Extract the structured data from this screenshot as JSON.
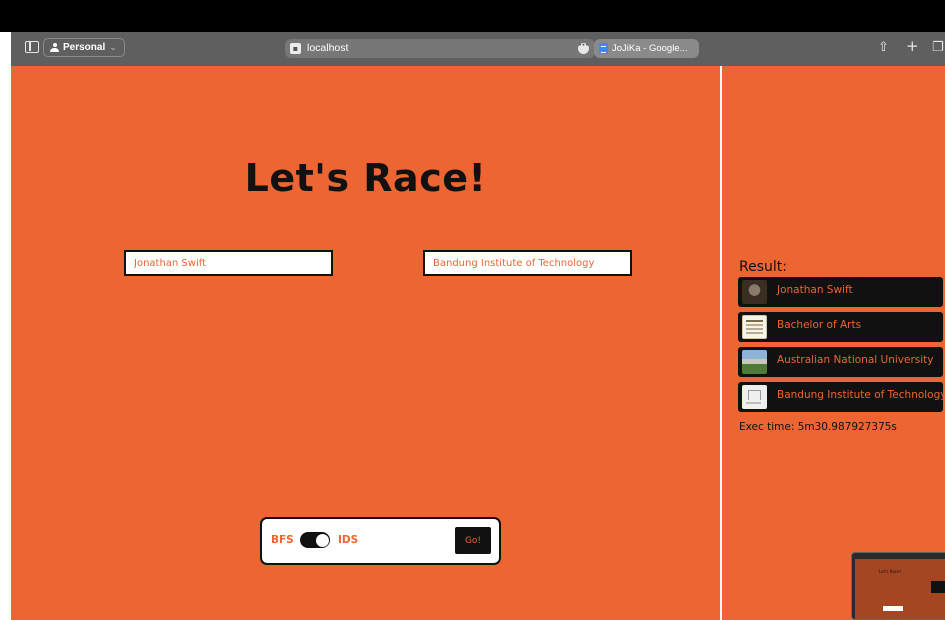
{
  "browser": {
    "profile_label": "Personal",
    "address": "localhost",
    "tab_title": "JoJiKa - Google..."
  },
  "main": {
    "title": "Let's Race!",
    "start_value": "Jonathan Swift",
    "end_value": "Bandung Institute of Technology",
    "algo_left": "BFS",
    "algo_right": "IDS",
    "toggle_on": true,
    "go_label": "Go!"
  },
  "result": {
    "label": "Result:",
    "items": [
      {
        "label": "Jonathan Swift",
        "thumb": "portrait-image"
      },
      {
        "label": "Bachelor of Arts",
        "thumb": "document-image"
      },
      {
        "label": "Australian National University",
        "thumb": "campus-image"
      },
      {
        "label": "Bandung Institute of Technology",
        "thumb": "gate-image"
      }
    ],
    "exec_time": "Exec time: 5m30.987927375s"
  },
  "colors": {
    "accent": "#ec6532",
    "dark": "#111111",
    "toolbar": "#5f5f5f"
  }
}
